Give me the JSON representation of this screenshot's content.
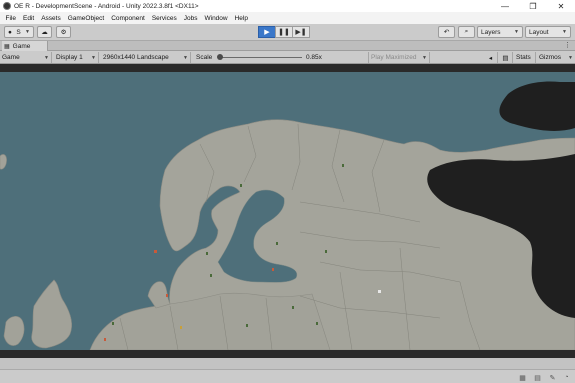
{
  "window": {
    "title": "OE R - DevelopmentScene - Android - Unity 2022.3.8f1 <DX11>",
    "minimize_glyph": "—",
    "maximize_glyph": "❐",
    "close_glyph": "✕"
  },
  "menu": [
    "File",
    "Edit",
    "Assets",
    "GameObject",
    "Component",
    "Services",
    "Jobs",
    "Window",
    "Help"
  ],
  "toolbar": {
    "account_label": "S",
    "play_icon": "▶",
    "pause_icon": "❚❚",
    "step_icon": "▶❚",
    "history_icon": "↶",
    "search_icon": "⌕",
    "layers_label": "Layers",
    "layout_label": "Layout"
  },
  "tab": {
    "label": "Game",
    "more_glyph": "⋮"
  },
  "game_toolbar": {
    "mode": "Game",
    "display": "Display 1",
    "resolution": "2960x1440 Landscape",
    "scale_label": "Scale",
    "scale_value": "0.85x",
    "play_mode": "Play Maximized",
    "stats_label": "Stats",
    "gizmos_label": "Gizmos"
  },
  "colors": {
    "sea": "#4e6f7a",
    "land": "#a3a39a",
    "dark_land": "#1f1f1f",
    "play_active": "#3a77c9"
  }
}
